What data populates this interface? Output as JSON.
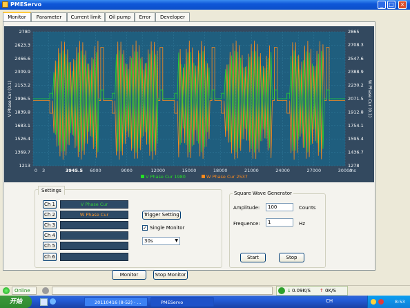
{
  "window": {
    "title": "PMEServo",
    "min_label": "_",
    "max_label": "□",
    "close_label": "×"
  },
  "tabs": [
    {
      "label": "Monitor",
      "active": true
    },
    {
      "label": "Parameter"
    },
    {
      "label": "Current limit"
    },
    {
      "label": "Oil pump"
    },
    {
      "label": "Error"
    },
    {
      "label": "Developer"
    }
  ],
  "chart_data": {
    "type": "line",
    "ylabel_left": "V Phase Cur (0.1)",
    "ylabel_right": "W Phase Cur (0.1)",
    "xunit": "ms",
    "x_ticks": [
      "0",
      "3",
      "3945.5",
      "6000",
      "9000",
      "12000",
      "15000",
      "18000",
      "21000",
      "24000",
      "27000",
      "30000"
    ],
    "y_left_ticks": [
      "2780",
      "2623.3",
      "2466.6",
      "2309.9",
      "2153.2",
      "1996.5",
      "1839.8",
      "1683.1",
      "1526.4",
      "1369.7",
      "1213"
    ],
    "y_right_ticks": [
      "2865",
      "2708.3",
      "2547.6",
      "2388.9",
      "2230.2",
      "2071.5",
      "1912.8",
      "1754.1",
      "1595.4",
      "1436.7",
      "1278"
    ],
    "ylim_left": [
      1213,
      2780
    ],
    "ylim_right": [
      1278,
      2865
    ],
    "xlim": [
      0,
      30000
    ],
    "grid": true,
    "series": [
      {
        "name": "V Phase Cur",
        "legend_value": "1980",
        "color": "#26e026"
      },
      {
        "name": "W Phase Cur",
        "legend_value": "2537",
        "color": "#ff8a1c"
      }
    ],
    "bursts": [
      {
        "start": 2000,
        "end": 6300
      },
      {
        "start": 8000,
        "end": 12000
      },
      {
        "start": 14000,
        "end": 17000
      },
      {
        "start": 18500,
        "end": 23000
      },
      {
        "start": 24800,
        "end": 28000
      }
    ],
    "baseline_left": 1996.5,
    "baseline_right": 2050
  },
  "settings": {
    "title": "Settings",
    "channels": [
      {
        "label": "Ch 1",
        "value": "V Phase Cur",
        "kind": "v"
      },
      {
        "label": "Ch 2",
        "value": "W Phase Cur",
        "kind": "w"
      },
      {
        "label": "Ch 3",
        "value": ""
      },
      {
        "label": "Ch 4",
        "value": ""
      },
      {
        "label": "Ch 5",
        "value": ""
      },
      {
        "label": "Ch 6",
        "value": ""
      }
    ],
    "trigger_label": "Trigger Setting",
    "single_monitor_label": "Single Monitor",
    "single_monitor_checked": true,
    "duration": "30s"
  },
  "square_wave": {
    "title": "Square Wave Generator",
    "amplitude_label": "Amplitude:",
    "amplitude_value": "100",
    "amplitude_unit": "Counts",
    "frequence_label": "Frequence:",
    "frequence_value": "1",
    "frequence_unit": "Hz",
    "start_label": "Start",
    "stop_label": "Stop"
  },
  "monitor_buttons": {
    "monitor": "Monitor",
    "stop": "Stop Monitor"
  },
  "status": {
    "online": "Online",
    "net_down": "0.09K/S",
    "net_up": "0K/S"
  },
  "taskbar": {
    "start": "开始",
    "tasks": [
      {
        "label": "20110416 (8-52) - ..."
      },
      {
        "label": "PMEServo"
      }
    ],
    "tray_lang": "CH",
    "clock": "8:53"
  }
}
